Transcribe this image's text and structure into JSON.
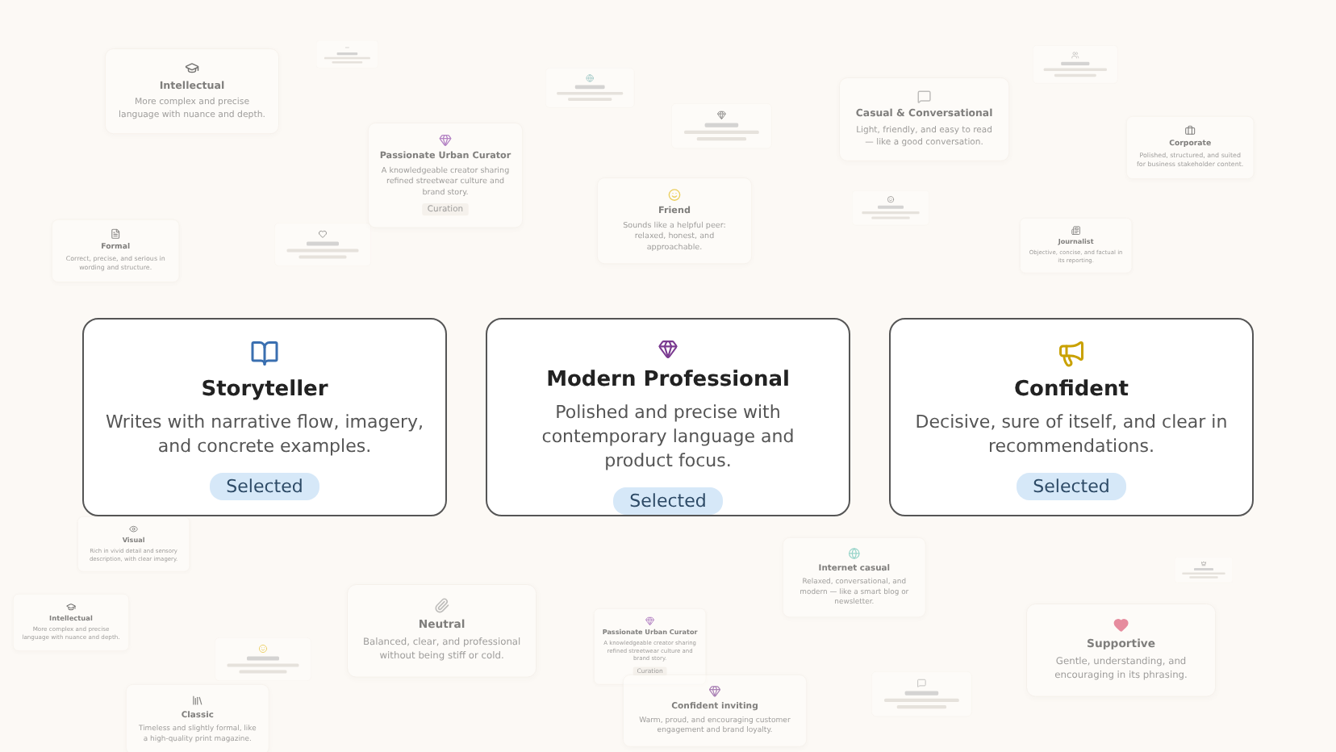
{
  "background_cards": [
    {
      "title": "Intellectual",
      "description": "More complex and precise language with nuance and depth."
    },
    {
      "title": "Passionate Urban Curator",
      "description": "A knowledgeable creator sharing refined streetwear culture and brand story.",
      "tag": "Curation"
    },
    {
      "title": "Formal",
      "description": "Correct, precise, and serious in wording and structure."
    },
    {
      "title": "Friend",
      "description": "Sounds like a helpful peer: relaxed, honest, and approachable."
    },
    {
      "title": "Casual & Conversational",
      "description": "Light, friendly, and easy to read — like a good conversation."
    },
    {
      "title": "Corporate",
      "description": "Polished, structured, and suited for business stakeholder content."
    },
    {
      "title": "Journalist",
      "description": "Objective, concise, and factual in its reporting."
    },
    {
      "title": "Visual",
      "description": "Rich in vivid detail and sensory description, with clear imagery."
    },
    {
      "title": "Intellectual",
      "description": "More complex and precise language with nuance and depth."
    },
    {
      "title": "Neutral",
      "description": "Balanced, clear, and professional without being stiff or cold."
    },
    {
      "title": "Classic",
      "description": "Timeless and slightly formal, like a high-quality print magazine."
    },
    {
      "title": "Passionate Urban Curator",
      "description": "A knowledgeable creator sharing refined streetwear culture and brand story.",
      "tag": "Curation"
    },
    {
      "title": "Internet casual",
      "description": "Relaxed, conversational, and modern — like a smart blog or newsletter."
    },
    {
      "title": "Confident inviting",
      "description": "Warm, proud, and encouraging customer engagement and brand loyalty."
    },
    {
      "title": "Supportive",
      "description": "Gentle, understanding, and encouraging in its phrasing."
    }
  ],
  "featured_cards": [
    {
      "title": "Storyteller",
      "description": "Writes with narrative flow, imagery, and concrete examples.",
      "selected": true,
      "badge": "Selected"
    },
    {
      "title": "Modern Professional",
      "description": "Polished and precise with contemporary language and product focus.",
      "selected": true,
      "badge": "Selected"
    },
    {
      "title": "Confident",
      "description": "Decisive, sure of itself, and clear in recommendations.",
      "selected": true,
      "badge": "Selected"
    }
  ]
}
